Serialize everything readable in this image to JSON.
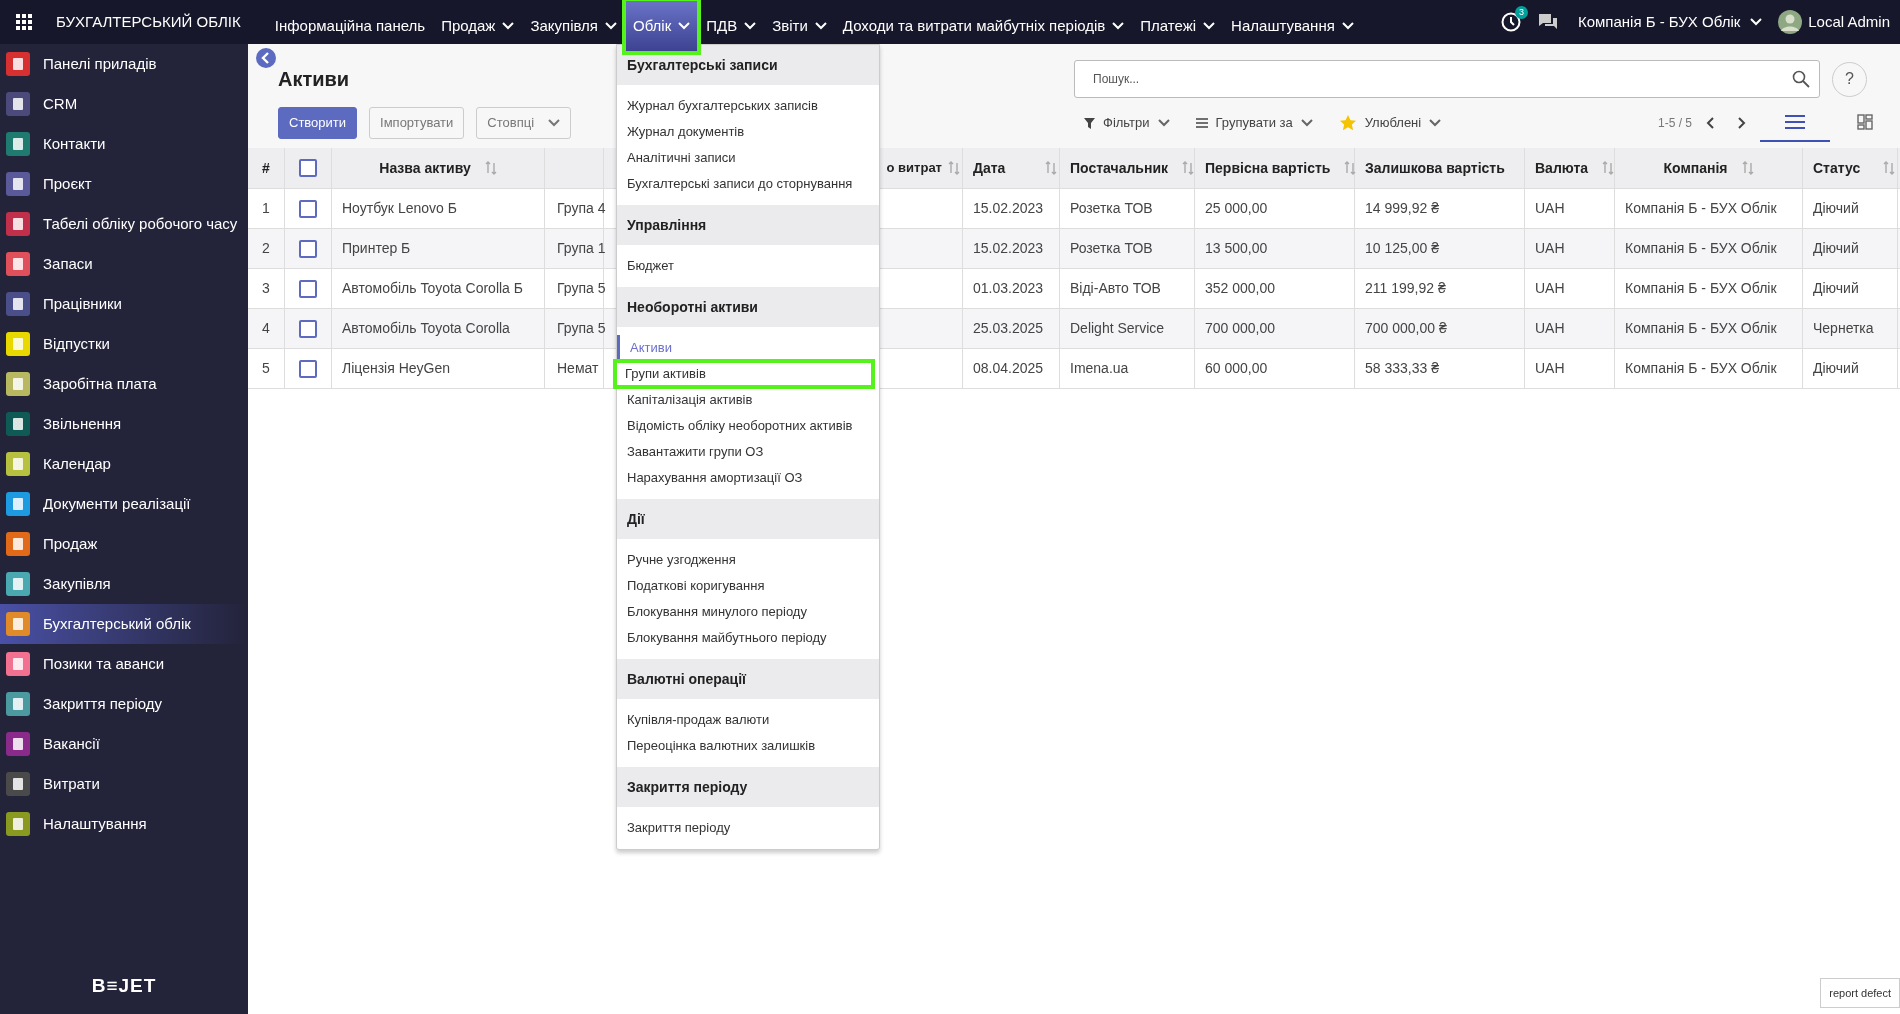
{
  "app_title": "БУХГАЛТЕРСЬКИЙ ОБЛІК",
  "nav": [
    {
      "label": "Інформаційна панель",
      "dropdown": false,
      "selected": false,
      "highlighted": false
    },
    {
      "label": "Продаж",
      "dropdown": true,
      "selected": false,
      "highlighted": false
    },
    {
      "label": "Закупівля",
      "dropdown": true,
      "selected": false,
      "highlighted": false
    },
    {
      "label": "Облік",
      "dropdown": true,
      "selected": true,
      "highlighted": true
    },
    {
      "label": "ПДВ",
      "dropdown": true,
      "selected": false,
      "highlighted": false
    },
    {
      "label": "Звіти",
      "dropdown": true,
      "selected": false,
      "highlighted": false
    },
    {
      "label": "Доходи та витрати майбутніх періодів",
      "dropdown": true,
      "selected": false,
      "highlighted": false
    },
    {
      "label": "Платежі",
      "dropdown": true,
      "selected": false,
      "highlighted": false
    },
    {
      "label": "Налаштування",
      "dropdown": true,
      "selected": false,
      "highlighted": false
    }
  ],
  "activity_badge": "3",
  "company": "Компанія Б - БУХ Облік",
  "user": "Local Admin",
  "sidebar": {
    "items": [
      {
        "label": "Панелі приладів",
        "color": "#d63031",
        "selected": false
      },
      {
        "label": "CRM",
        "color": "#4b4a7a",
        "selected": false
      },
      {
        "label": "Контакти",
        "color": "#1f7a6f",
        "selected": false
      },
      {
        "label": "Проєкт",
        "color": "#5a5a9a",
        "selected": false
      },
      {
        "label": "Табелі обліку робочого часу",
        "color": "#c0304a",
        "selected": false
      },
      {
        "label": "Запаси",
        "color": "#e0505a",
        "selected": false
      },
      {
        "label": "Працівники",
        "color": "#4a4f8a",
        "selected": false
      },
      {
        "label": "Відпустки",
        "color": "#e8d800",
        "selected": false
      },
      {
        "label": "Заробітна плата",
        "color": "#b8b860",
        "selected": false
      },
      {
        "label": "Звільнення",
        "color": "#0f5a55",
        "selected": false
      },
      {
        "label": "Календар",
        "color": "#b8c040",
        "selected": false
      },
      {
        "label": "Документи реалізації",
        "color": "#1e9be0",
        "selected": false
      },
      {
        "label": "Продаж",
        "color": "#e06a1a",
        "selected": false
      },
      {
        "label": "Закупівля",
        "color": "#4aa8b0",
        "selected": false
      },
      {
        "label": "Бухгалтерський облік",
        "color": "#e08a2a",
        "selected": true
      },
      {
        "label": "Позики та аванси",
        "color": "#f27090",
        "selected": false
      },
      {
        "label": "Закриття періоду",
        "color": "#4a9aa0",
        "selected": false
      },
      {
        "label": "Вакансії",
        "color": "#8a2a8a",
        "selected": false
      },
      {
        "label": "Витрати",
        "color": "#4a4a4a",
        "selected": false
      },
      {
        "label": "Налаштування",
        "color": "#8a9a20",
        "selected": false
      }
    ],
    "logo": "B≡JET"
  },
  "page": {
    "title": "Активи",
    "buttons": [
      {
        "label": "Створити",
        "kind": "primary"
      },
      {
        "label": "Імпортувати",
        "kind": "secondary"
      },
      {
        "label": "Стовпці",
        "kind": "dropdown"
      }
    ]
  },
  "search": {
    "placeholder": "Пошук..."
  },
  "help": "?",
  "filters": [
    {
      "label": "Фільтри",
      "kind": "filter"
    },
    {
      "label": "Групувати за",
      "kind": "group"
    },
    {
      "label": "Улюблені",
      "kind": "favorite"
    }
  ],
  "pager": "1-5 / 5",
  "views": [
    {
      "kind": "list",
      "selected": true
    },
    {
      "kind": "kanban",
      "selected": false
    }
  ],
  "table": {
    "header_checked": false,
    "columns": [
      {
        "label": "#",
        "sortable": false
      },
      {
        "kind": "checkbox"
      },
      {
        "label": "Назва активу",
        "sortable": true
      },
      {
        "sortable": false
      },
      {
        "label": "о витрат",
        "sortable": true
      },
      {
        "label": "Дата",
        "sortable": true
      },
      {
        "label": "Постачальник",
        "sortable": true
      },
      {
        "label": "Первісна вартість",
        "sortable": true
      },
      {
        "label": "Залишкова вартість",
        "sortable": false
      },
      {
        "label": "Валюта",
        "sortable": true
      },
      {
        "label": "Компанія",
        "sortable": true
      },
      {
        "label": "Статус",
        "sortable": true
      }
    ],
    "rows": [
      {
        "number": "1",
        "checked": false,
        "name": "Ноутбук Lenovo Б",
        "column_4": "Група 4",
        "date": "15.02.2023",
        "supplier": "Розетка ТОВ",
        "cost": "25 000,00",
        "residual": "14 999,92 ₴",
        "currency": "UAH",
        "company": "Компанія Б - БУХ Облік",
        "status": "Діючий"
      },
      {
        "number": "2",
        "checked": false,
        "name": "Принтер Б",
        "column_4": "Група 1",
        "date": "15.02.2023",
        "supplier": "Розетка ТОВ",
        "cost": "13 500,00",
        "residual": "10 125,00 ₴",
        "currency": "UAH",
        "company": "Компанія Б - БУХ Облік",
        "status": "Діючий"
      },
      {
        "number": "3",
        "checked": false,
        "name": "Автомобіль Toyota Corolla Б",
        "column_4": "Група 5",
        "date": "01.03.2023",
        "supplier": "Віді-Авто ТОВ",
        "cost": "352 000,00",
        "residual": "211 199,92 ₴",
        "currency": "UAH",
        "company": "Компанія Б - БУХ Облік",
        "status": "Діючий"
      },
      {
        "number": "4",
        "checked": false,
        "name": "Автомобіль Toyota Corolla",
        "column_4": "Група 5",
        "date": "25.03.2025",
        "supplier": "Delight Service",
        "cost": "700 000,00",
        "residual": "700 000,00 ₴",
        "currency": "UAH",
        "company": "Компанія Б - БУХ Облік",
        "status": "Чернетка"
      },
      {
        "number": "5",
        "checked": false,
        "name": "Ліцензія HeyGen",
        "column_4": "Немат",
        "date": "08.04.2025",
        "supplier": "Imena.ua",
        "cost": "60 000,00",
        "residual": "58 333,33 ₴",
        "currency": "UAH",
        "company": "Компанія Б - БУХ Облік",
        "status": "Діючий"
      }
    ]
  },
  "menu": {
    "sections": [
      {
        "title": "Бухгалтерські записи",
        "items": [
          {
            "label": "Журнал бухгалтерських записів",
            "selected": false,
            "highlighted": false
          },
          {
            "label": "Журнал документів",
            "selected": false,
            "highlighted": false
          },
          {
            "label": "Аналітичні записи",
            "selected": false,
            "highlighted": false
          },
          {
            "label": "Бухгалтерські записи до сторнування",
            "selected": false,
            "highlighted": false
          }
        ]
      },
      {
        "title": "Управління",
        "items": [
          {
            "label": "Бюджет",
            "selected": false,
            "highlighted": false
          }
        ]
      },
      {
        "title": "Необоротні активи",
        "items": [
          {
            "label": "Активи",
            "selected": true,
            "highlighted": false
          },
          {
            "label": "Групи активів",
            "selected": false,
            "highlighted": true
          },
          {
            "label": "Капіталізація активів",
            "selected": false,
            "highlighted": false
          },
          {
            "label": "Відомість обліку необоротних активів",
            "selected": false,
            "highlighted": false
          },
          {
            "label": "Завантажити групи ОЗ",
            "selected": false,
            "highlighted": false
          },
          {
            "label": "Нарахування амортизації ОЗ",
            "selected": false,
            "highlighted": false
          }
        ]
      },
      {
        "title": "Дії",
        "items": [
          {
            "label": "Ручне узгодження",
            "selected": false,
            "highlighted": false
          },
          {
            "label": "Податкові коригування",
            "selected": false,
            "highlighted": false
          },
          {
            "label": "Блокування минулого періоду",
            "selected": false,
            "highlighted": false
          },
          {
            "label": "Блокування майбутнього періоду",
            "selected": false,
            "highlighted": false
          }
        ]
      },
      {
        "title": "Валютні операції",
        "items": [
          {
            "label": "Купівля-продаж валюти",
            "selected": false,
            "highlighted": false
          },
          {
            "label": "Переоцінка валютних залишків",
            "selected": false,
            "highlighted": false
          }
        ]
      },
      {
        "title": "Закриття періоду",
        "items": [
          {
            "label": "Закриття періоду",
            "selected": false,
            "highlighted": false
          }
        ]
      }
    ]
  },
  "report_button": "report defect"
}
